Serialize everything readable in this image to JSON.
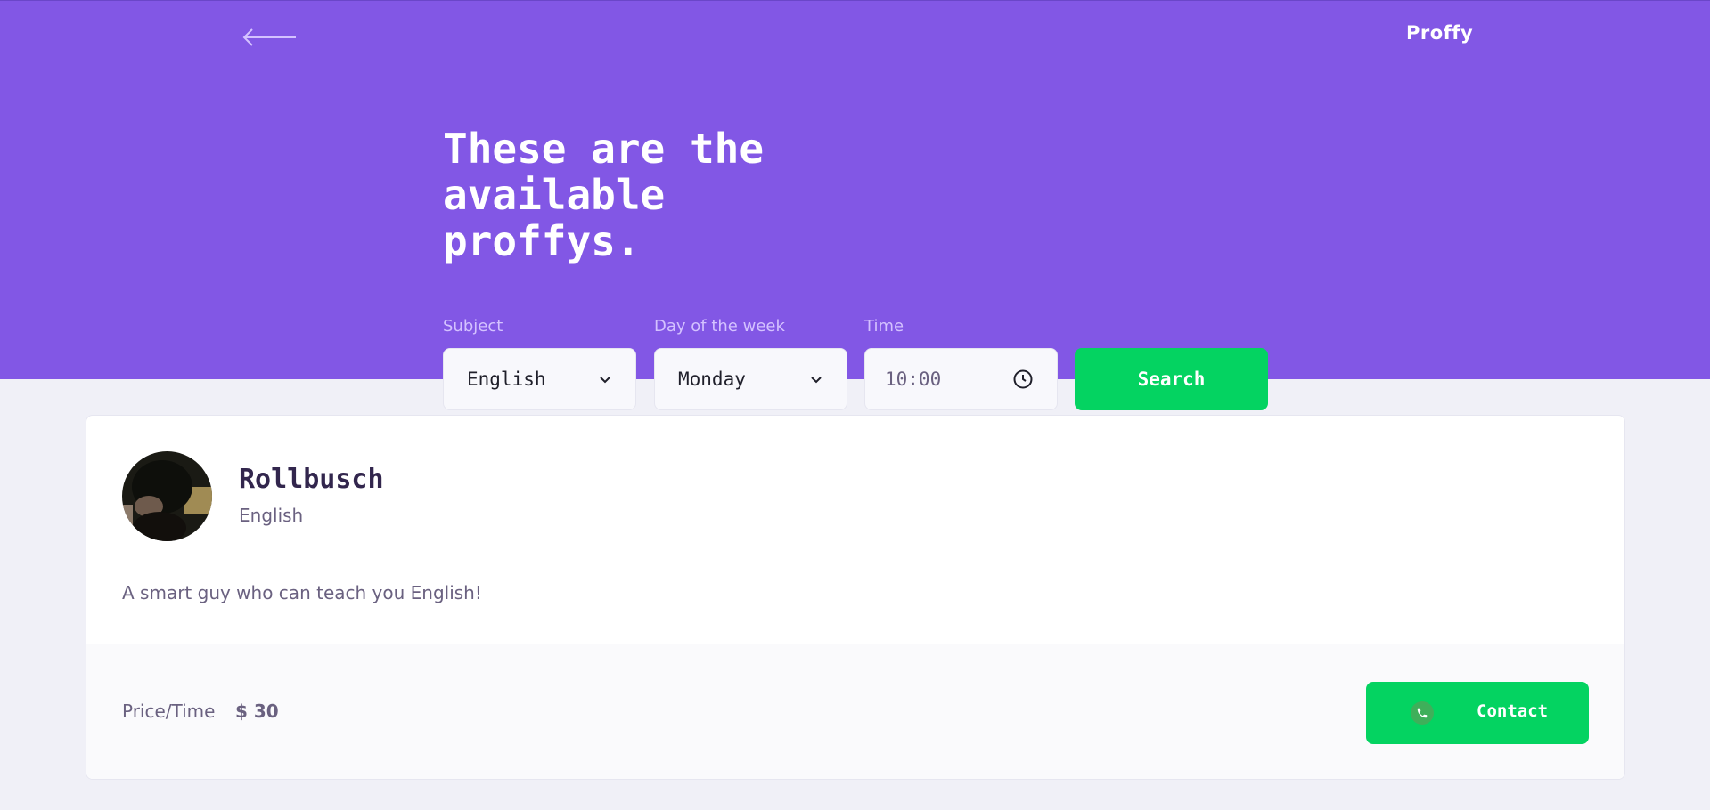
{
  "header": {
    "back_icon": "arrow-left-icon",
    "logo": "Proffy",
    "title": "These are the available proffys.",
    "bg_color": "#8257E5"
  },
  "filters": {
    "subject": {
      "label": "Subject",
      "value": "English"
    },
    "weekday": {
      "label": "Day of the week",
      "value": "Monday"
    },
    "time": {
      "label": "Time",
      "value": "10:00",
      "icon": "clock-icon"
    },
    "search_label": "Search"
  },
  "teacher": {
    "name": "Rollbusch",
    "subject": "English",
    "bio": "A smart guy who can teach you English!",
    "price_label": "Price/Time",
    "price_value": "$ 30",
    "contact_label": "Contact",
    "contact_icon": "whatsapp-icon"
  },
  "colors": {
    "primary": "#8257E5",
    "secondary": "#04D361",
    "background": "#F0F0F7"
  }
}
